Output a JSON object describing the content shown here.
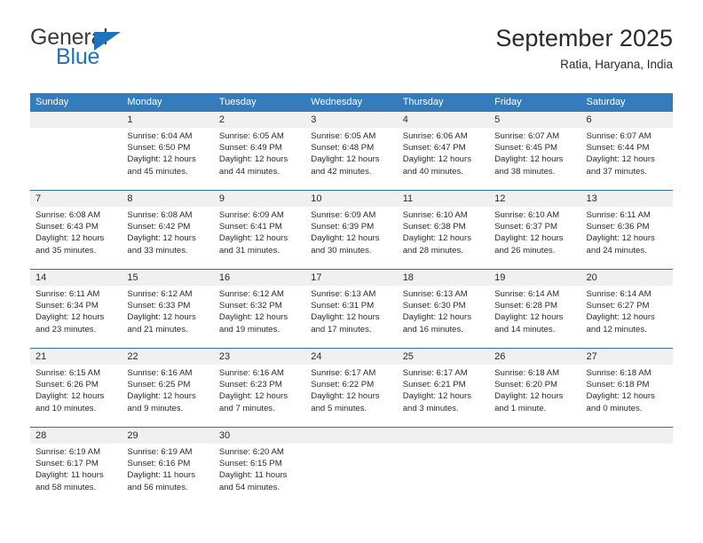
{
  "brand": {
    "name_part1": "General",
    "name_part2": "Blue",
    "triangle_icon": "triangle-icon",
    "accent_color": "#1f72bd"
  },
  "header": {
    "title": "September 2025",
    "location": "Ratia, Haryana, India"
  },
  "calendar": {
    "header_color": "#357cbd",
    "date_band_color": "#f0f0f0",
    "weekdays": [
      "Sunday",
      "Monday",
      "Tuesday",
      "Wednesday",
      "Thursday",
      "Friday",
      "Saturday"
    ],
    "weeks": [
      [
        {
          "day": "",
          "lines": []
        },
        {
          "day": "1",
          "lines": [
            "Sunrise: 6:04 AM",
            "Sunset: 6:50 PM",
            "Daylight: 12 hours",
            "and 45 minutes."
          ]
        },
        {
          "day": "2",
          "lines": [
            "Sunrise: 6:05 AM",
            "Sunset: 6:49 PM",
            "Daylight: 12 hours",
            "and 44 minutes."
          ]
        },
        {
          "day": "3",
          "lines": [
            "Sunrise: 6:05 AM",
            "Sunset: 6:48 PM",
            "Daylight: 12 hours",
            "and 42 minutes."
          ]
        },
        {
          "day": "4",
          "lines": [
            "Sunrise: 6:06 AM",
            "Sunset: 6:47 PM",
            "Daylight: 12 hours",
            "and 40 minutes."
          ]
        },
        {
          "day": "5",
          "lines": [
            "Sunrise: 6:07 AM",
            "Sunset: 6:45 PM",
            "Daylight: 12 hours",
            "and 38 minutes."
          ]
        },
        {
          "day": "6",
          "lines": [
            "Sunrise: 6:07 AM",
            "Sunset: 6:44 PM",
            "Daylight: 12 hours",
            "and 37 minutes."
          ]
        }
      ],
      [
        {
          "day": "7",
          "lines": [
            "Sunrise: 6:08 AM",
            "Sunset: 6:43 PM",
            "Daylight: 12 hours",
            "and 35 minutes."
          ]
        },
        {
          "day": "8",
          "lines": [
            "Sunrise: 6:08 AM",
            "Sunset: 6:42 PM",
            "Daylight: 12 hours",
            "and 33 minutes."
          ]
        },
        {
          "day": "9",
          "lines": [
            "Sunrise: 6:09 AM",
            "Sunset: 6:41 PM",
            "Daylight: 12 hours",
            "and 31 minutes."
          ]
        },
        {
          "day": "10",
          "lines": [
            "Sunrise: 6:09 AM",
            "Sunset: 6:39 PM",
            "Daylight: 12 hours",
            "and 30 minutes."
          ]
        },
        {
          "day": "11",
          "lines": [
            "Sunrise: 6:10 AM",
            "Sunset: 6:38 PM",
            "Daylight: 12 hours",
            "and 28 minutes."
          ]
        },
        {
          "day": "12",
          "lines": [
            "Sunrise: 6:10 AM",
            "Sunset: 6:37 PM",
            "Daylight: 12 hours",
            "and 26 minutes."
          ]
        },
        {
          "day": "13",
          "lines": [
            "Sunrise: 6:11 AM",
            "Sunset: 6:36 PM",
            "Daylight: 12 hours",
            "and 24 minutes."
          ]
        }
      ],
      [
        {
          "day": "14",
          "lines": [
            "Sunrise: 6:11 AM",
            "Sunset: 6:34 PM",
            "Daylight: 12 hours",
            "and 23 minutes."
          ]
        },
        {
          "day": "15",
          "lines": [
            "Sunrise: 6:12 AM",
            "Sunset: 6:33 PM",
            "Daylight: 12 hours",
            "and 21 minutes."
          ]
        },
        {
          "day": "16",
          "lines": [
            "Sunrise: 6:12 AM",
            "Sunset: 6:32 PM",
            "Daylight: 12 hours",
            "and 19 minutes."
          ]
        },
        {
          "day": "17",
          "lines": [
            "Sunrise: 6:13 AM",
            "Sunset: 6:31 PM",
            "Daylight: 12 hours",
            "and 17 minutes."
          ]
        },
        {
          "day": "18",
          "lines": [
            "Sunrise: 6:13 AM",
            "Sunset: 6:30 PM",
            "Daylight: 12 hours",
            "and 16 minutes."
          ]
        },
        {
          "day": "19",
          "lines": [
            "Sunrise: 6:14 AM",
            "Sunset: 6:28 PM",
            "Daylight: 12 hours",
            "and 14 minutes."
          ]
        },
        {
          "day": "20",
          "lines": [
            "Sunrise: 6:14 AM",
            "Sunset: 6:27 PM",
            "Daylight: 12 hours",
            "and 12 minutes."
          ]
        }
      ],
      [
        {
          "day": "21",
          "lines": [
            "Sunrise: 6:15 AM",
            "Sunset: 6:26 PM",
            "Daylight: 12 hours",
            "and 10 minutes."
          ]
        },
        {
          "day": "22",
          "lines": [
            "Sunrise: 6:16 AM",
            "Sunset: 6:25 PM",
            "Daylight: 12 hours",
            "and 9 minutes."
          ]
        },
        {
          "day": "23",
          "lines": [
            "Sunrise: 6:16 AM",
            "Sunset: 6:23 PM",
            "Daylight: 12 hours",
            "and 7 minutes."
          ]
        },
        {
          "day": "24",
          "lines": [
            "Sunrise: 6:17 AM",
            "Sunset: 6:22 PM",
            "Daylight: 12 hours",
            "and 5 minutes."
          ]
        },
        {
          "day": "25",
          "lines": [
            "Sunrise: 6:17 AM",
            "Sunset: 6:21 PM",
            "Daylight: 12 hours",
            "and 3 minutes."
          ]
        },
        {
          "day": "26",
          "lines": [
            "Sunrise: 6:18 AM",
            "Sunset: 6:20 PM",
            "Daylight: 12 hours",
            "and 1 minute."
          ]
        },
        {
          "day": "27",
          "lines": [
            "Sunrise: 6:18 AM",
            "Sunset: 6:18 PM",
            "Daylight: 12 hours",
            "and 0 minutes."
          ]
        }
      ],
      [
        {
          "day": "28",
          "lines": [
            "Sunrise: 6:19 AM",
            "Sunset: 6:17 PM",
            "Daylight: 11 hours",
            "and 58 minutes."
          ]
        },
        {
          "day": "29",
          "lines": [
            "Sunrise: 6:19 AM",
            "Sunset: 6:16 PM",
            "Daylight: 11 hours",
            "and 56 minutes."
          ]
        },
        {
          "day": "30",
          "lines": [
            "Sunrise: 6:20 AM",
            "Sunset: 6:15 PM",
            "Daylight: 11 hours",
            "and 54 minutes."
          ]
        },
        {
          "day": "",
          "lines": []
        },
        {
          "day": "",
          "lines": []
        },
        {
          "day": "",
          "lines": []
        },
        {
          "day": "",
          "lines": []
        }
      ]
    ]
  }
}
